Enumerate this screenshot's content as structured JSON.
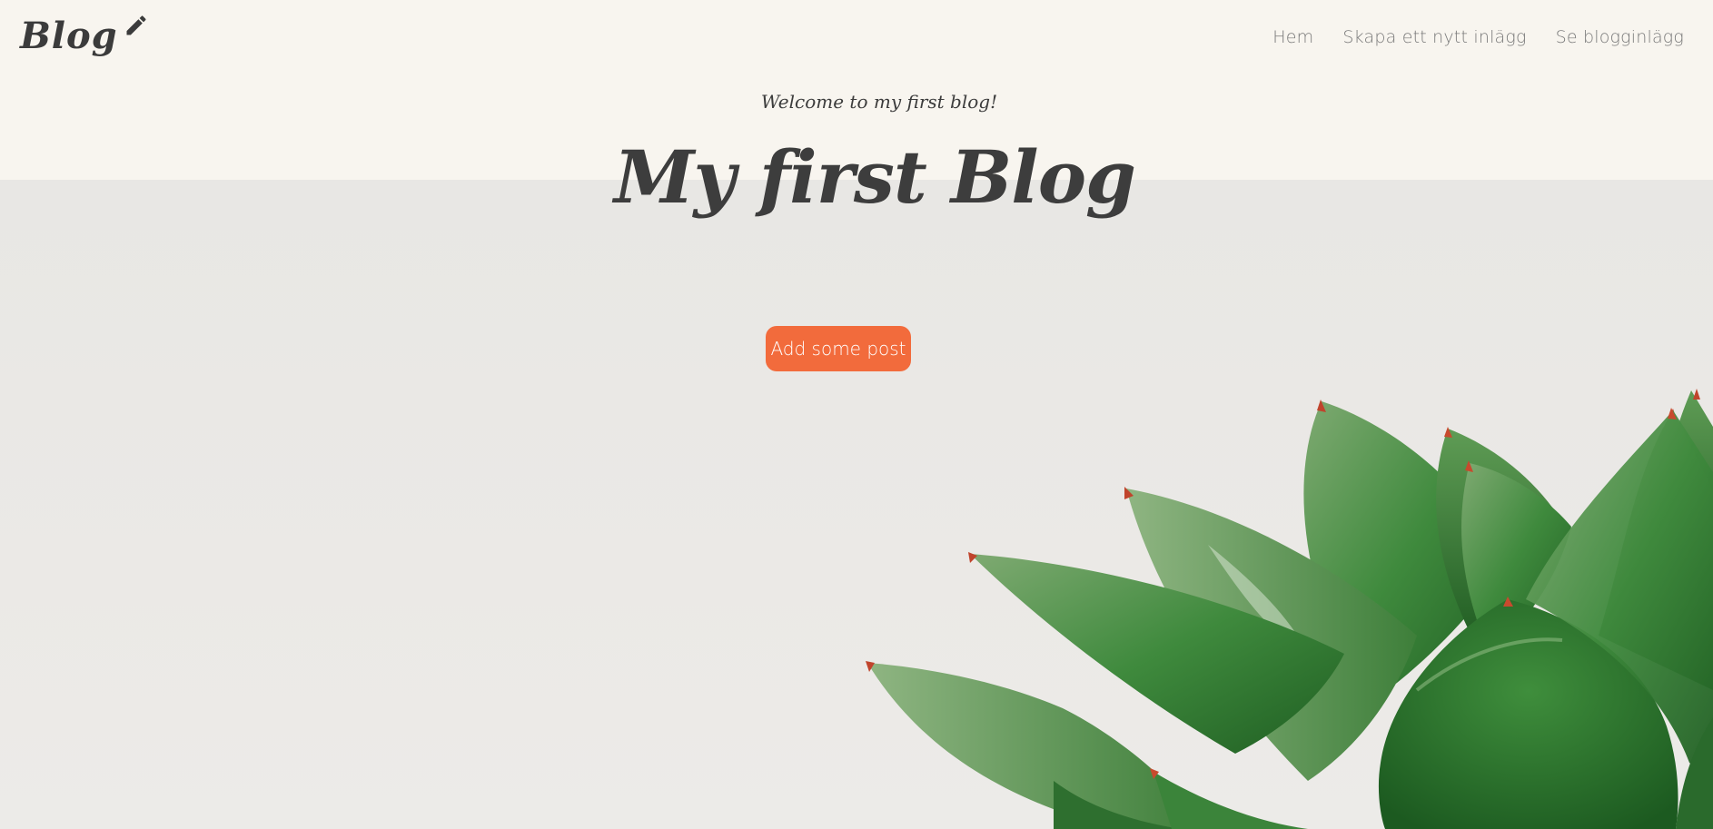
{
  "navbar": {
    "brand": "Blog",
    "links": [
      "Hem",
      "Skapa ett nytt inlägg",
      "Se blogginlägg"
    ]
  },
  "hero": {
    "welcome": "Welcome to my first blog!",
    "title": "My first Blog",
    "button_label": "Add some post"
  },
  "colors": {
    "accent": "#f26b3c",
    "top_band": "#f8f5ef",
    "hero_background": "#e9e8e5",
    "text_dark": "#3d3d3d",
    "nav_text": "#7a7a7a"
  },
  "icons": {
    "brand_icon": "pencil-icon",
    "hero_image": "succulent-plant"
  }
}
